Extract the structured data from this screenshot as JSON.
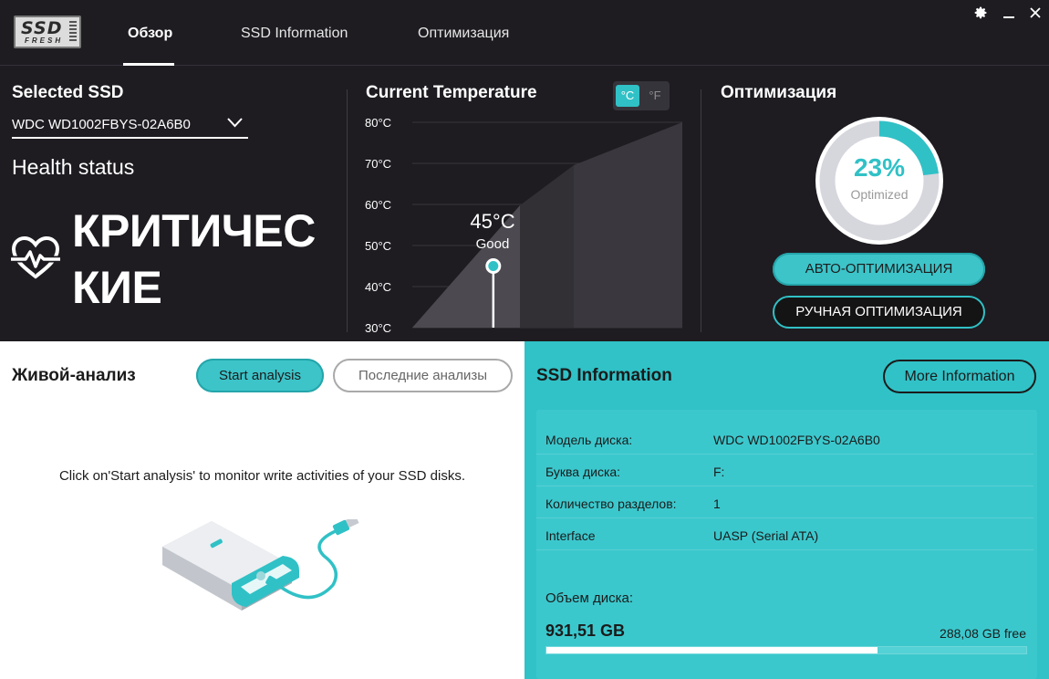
{
  "header": {
    "logo_text": "SSD",
    "logo_sub": "FRESH",
    "tabs": [
      {
        "label": "Обзор",
        "active": true
      },
      {
        "label": "SSD Information",
        "active": false
      },
      {
        "label": "Оптимизация",
        "active": false
      }
    ],
    "window_icons": [
      "gear-icon",
      "minimize-icon",
      "close-icon"
    ]
  },
  "selected_ssd": {
    "title": "Selected SSD",
    "drive": "WDC WD1002FBYS-02A6B0",
    "health_label": "Health status",
    "health_value": "КРИТИЧЕС КИЕ"
  },
  "temperature": {
    "title": "Current Temperature",
    "unit_c": "°C",
    "unit_f": "°F",
    "current_value": "45°C",
    "current_status": "Good",
    "current": 45,
    "ticks": [
      "80°C",
      "70°C",
      "60°C",
      "50°C",
      "40°C",
      "30°C"
    ],
    "range": [
      30,
      80
    ]
  },
  "optimization": {
    "title": "Оптимизация",
    "percent_label": "23%",
    "percent": 23,
    "sub_label": "Optimized",
    "auto_button": "АВТО-ОПТИМИЗАЦИЯ",
    "manual_button": "РУЧНАЯ ОПТИМИЗАЦИЯ"
  },
  "live_analysis": {
    "title": "Живой-анализ",
    "start_button": "Start analysis",
    "history_button": "Последние анализы",
    "message": "Click on'Start analysis' to monitor write activities of your SSD disks."
  },
  "ssd_info": {
    "title": "SSD Information",
    "more_button": "More Information",
    "rows": [
      {
        "key": "Модель диска:",
        "value": "WDC WD1002FBYS-02A6B0"
      },
      {
        "key": "Буква диска:",
        "value": "F:"
      },
      {
        "key": "Количество разделов:",
        "value": "1"
      },
      {
        "key": "Interface",
        "value": "UASP (Serial ATA)"
      }
    ],
    "capacity_label": "Объем диска:",
    "capacity_total": "931,51 GB",
    "capacity_free": "288,08 GB free",
    "used_fraction": 0.69
  },
  "colors": {
    "accent": "#30c1c6",
    "dark_bg": "#1e1c21",
    "info_bg": "#30c2c7"
  }
}
